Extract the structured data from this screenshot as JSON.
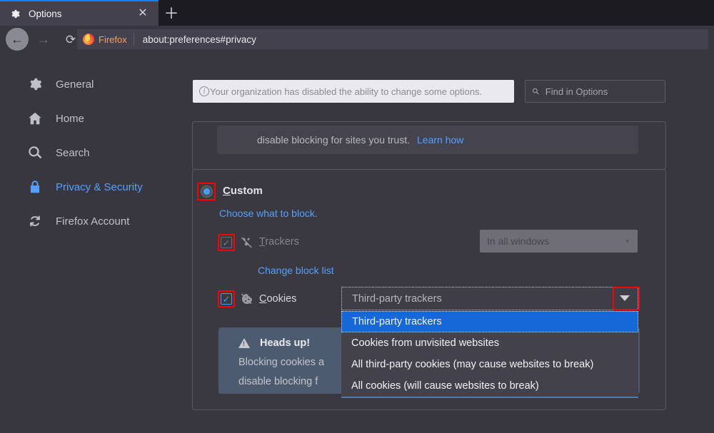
{
  "browser": {
    "tab": {
      "title": "Options",
      "favicon_icon": "gear-icon",
      "close_icon": "close-icon"
    },
    "new_tab_icon": "plus-icon",
    "back_icon": "arrow-left-icon",
    "forward_icon": "arrow-right-icon",
    "reload_icon": "reload-icon",
    "identity_label": "Firefox",
    "identity_icon": "firefox-logo-icon",
    "url": "about:preferences#privacy"
  },
  "sidebar": {
    "items": [
      {
        "label": "General",
        "icon": "gear-icon",
        "active": false
      },
      {
        "label": "Home",
        "icon": "home-icon",
        "active": false
      },
      {
        "label": "Search",
        "icon": "search-icon",
        "active": false
      },
      {
        "label": "Privacy & Security",
        "icon": "lock-icon",
        "active": true
      },
      {
        "label": "Firefox Account",
        "icon": "sync-icon",
        "active": false
      }
    ]
  },
  "header": {
    "notice_icon": "info-icon",
    "notice_text": "Your organization has disabled the ability to change some options.",
    "find_icon": "search-icon",
    "find_placeholder": "Find in Options"
  },
  "top_panel": {
    "text": "disable blocking for sites you trust.",
    "link": "Learn how"
  },
  "custom_section": {
    "radio_label": "Custom",
    "radio_label_accesskey": "C",
    "radio_selected": true,
    "choose_link": "Choose what to block.",
    "trackers": {
      "label": "Trackers",
      "accesskey": "T",
      "icon": "tracker-blocked-icon",
      "checked": true,
      "disabled": true,
      "select_value": "In all windows",
      "select_disabled": true,
      "select_arrow_icon": "chevron-down-icon"
    },
    "change_block_list_link": "Change block list",
    "cookies": {
      "label": "Cookies",
      "accesskey": "C",
      "icon": "cookie-blocked-icon",
      "checked": true,
      "select_value": "Third-party trackers",
      "select_arrow_icon": "chevron-down-icon",
      "options": [
        "Third-party trackers",
        "Cookies from unvisited websites",
        "All third-party cookies (may cause websites to break)",
        "All cookies (will cause websites to break)"
      ],
      "selected_index": 0
    },
    "heads_up": {
      "icon": "warning-icon",
      "title": "Heads up!",
      "line1": "Blocking cookies a",
      "line2": "disable blocking f"
    }
  },
  "colors": {
    "accent_blue": "#0a84ff",
    "link_blue": "#55a0ff",
    "highlight_red": "#ff0000",
    "selection_blue": "#1667d8",
    "warning_panel": "#4d5b70",
    "chrome_dark": "#1c1b22",
    "page_bg": "#38373f"
  }
}
